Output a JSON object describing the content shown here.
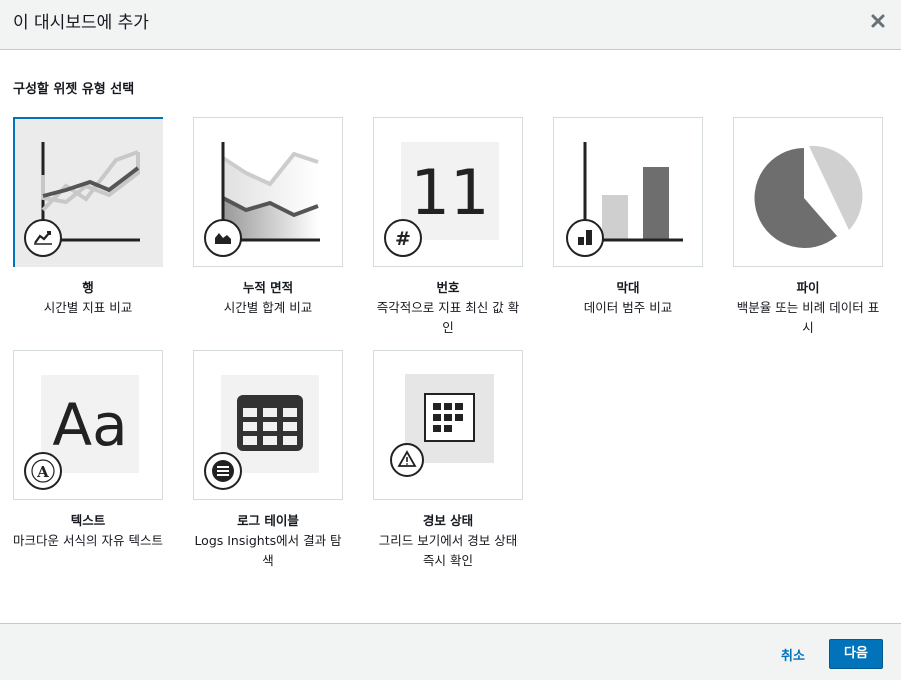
{
  "dialog": {
    "title": "이 대시보드에 추가",
    "close_icon": "close-icon"
  },
  "section_label": "구성할 위젯 유형 선택",
  "widgets": [
    {
      "id": "line",
      "title": "행",
      "desc": "시간별 지표 비교",
      "selected": true,
      "badge_icon": "line-chart-icon"
    },
    {
      "id": "stacked-area",
      "title": "누적 면적",
      "desc": "시간별 합계 비교",
      "selected": false,
      "badge_icon": "area-chart-icon"
    },
    {
      "id": "number",
      "title": "번호",
      "desc": "즉각적으로 지표 최신 값 확인",
      "selected": false,
      "badge_icon": "hash-icon",
      "preview_value": "11"
    },
    {
      "id": "bar",
      "title": "막대",
      "desc": "데이터 범주 비교",
      "selected": false,
      "badge_icon": "bar-chart-icon"
    },
    {
      "id": "pie",
      "title": "파이",
      "desc": "백분율 또는 비례 데이터 표시",
      "selected": false,
      "badge_icon": "pie-chart-icon"
    },
    {
      "id": "text",
      "title": "텍스트",
      "desc": "마크다운 서식의 자유 텍스트",
      "selected": false,
      "badge_icon": "text-icon",
      "preview_text": "Aa"
    },
    {
      "id": "logs-table",
      "title": "로그 테이블",
      "desc": "Logs Insights에서 결과 탐색",
      "selected": false,
      "badge_icon": "list-icon"
    },
    {
      "id": "alarm-status",
      "title": "경보 상태",
      "desc": "그리드 보기에서 경보 상태 즉시 확인",
      "selected": false,
      "badge_icon": "alarm-icon"
    }
  ],
  "footer": {
    "cancel_label": "취소",
    "next_label": "다음"
  },
  "colors": {
    "accent": "#0073bb",
    "header_bg": "#f2f3f3",
    "border": "#d5dbdb"
  }
}
